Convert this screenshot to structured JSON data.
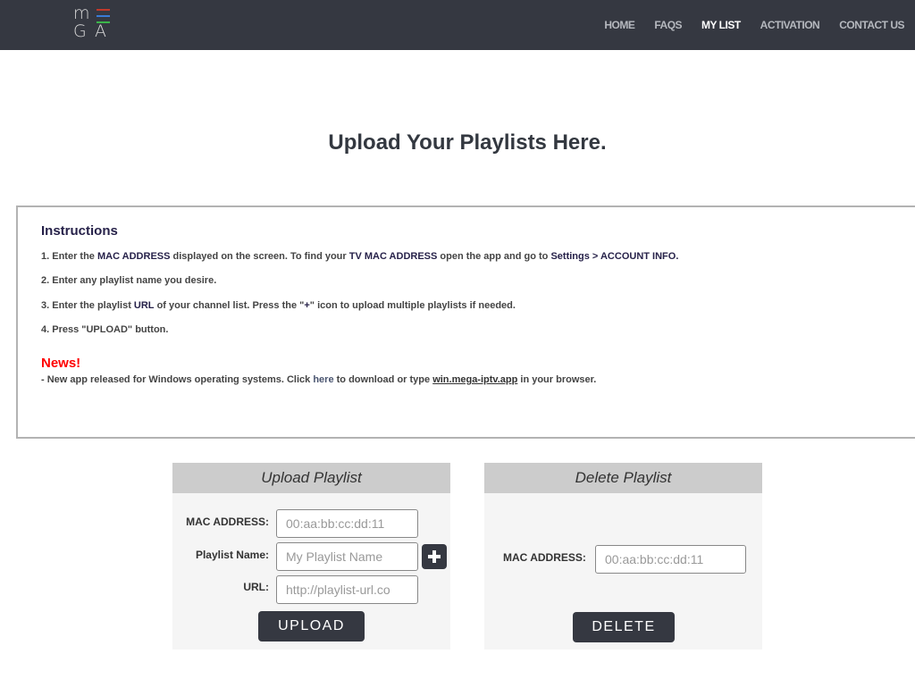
{
  "header": {
    "logo": {
      "letters": [
        "m",
        "G",
        "A"
      ],
      "bar_colors": [
        "#c0392b",
        "#3a7bd5",
        "#3cb54a"
      ]
    },
    "nav": [
      {
        "label": "HOME",
        "active": false
      },
      {
        "label": "FAQS",
        "active": false
      },
      {
        "label": "MY LIST",
        "active": true
      },
      {
        "label": "ACTIVATION",
        "active": false
      },
      {
        "label": "CONTACT US",
        "active": false
      }
    ]
  },
  "page_title": "Upload Your Playlists Here.",
  "instructions": {
    "title": "Instructions",
    "steps": [
      {
        "pre": "1. Enter the ",
        "b1": "MAC ADDRESS",
        "mid": " displayed on the screen. To find your ",
        "b2": "TV MAC ADDRESS",
        "mid2": " open the app and go to ",
        "b3": "Settings > ACCOUNT INFO."
      },
      {
        "text": "2. Enter any playlist name you desire."
      },
      {
        "pre": "3. Enter the playlist ",
        "b1": "URL",
        "mid": " of your channel list. Press the \"",
        "b2": "+",
        "mid2": "\" icon to upload multiple playlists if needed."
      },
      {
        "text": "4. Press \"UPLOAD\" button."
      }
    ],
    "news_title": "News!",
    "news": {
      "pre": "- New app released for Windows operating systems. Click ",
      "link": "here",
      "mid": " to download or type ",
      "url": "win.mega-iptv.app",
      "post": " in your browser."
    }
  },
  "upload_panel": {
    "title": "Upload Playlist",
    "mac_label": "MAC ADDRESS:",
    "mac_placeholder": "00:aa:bb:cc:dd:11",
    "name_label": "Playlist Name:",
    "name_placeholder": "My Playlist Name",
    "url_label": "URL:",
    "url_placeholder": "http://playlist-url.co",
    "button": "UPLOAD"
  },
  "delete_panel": {
    "title": "Delete Playlist",
    "mac_label": "MAC ADDRESS:",
    "mac_placeholder": "00:aa:bb:cc:dd:11",
    "button": "DELETE"
  }
}
